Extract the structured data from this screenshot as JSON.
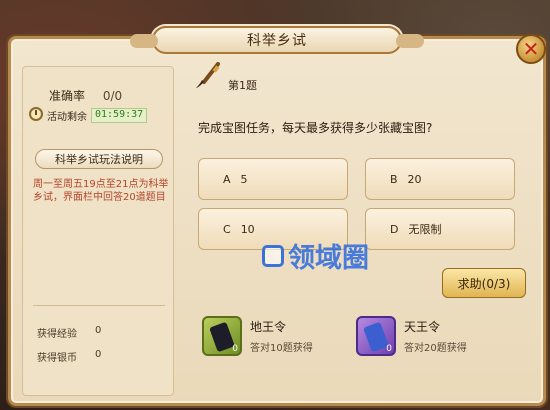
{
  "window": {
    "title": "科举乡试"
  },
  "stats": {
    "accuracy_label": "准确率",
    "accuracy_value": "0/0",
    "timer_label": "活动剩余",
    "timer_value": "01:59:37"
  },
  "rules": {
    "button_label": "科举乡试玩法说明",
    "description": "周一至周五19点至21点为科举乡试，界面栏中回答20道题目"
  },
  "rewards": {
    "exp_label": "获得经验",
    "exp_value": "0",
    "silver_label": "获得银币",
    "silver_value": "0"
  },
  "question": {
    "number_label": "第1题",
    "text": "完成宝图任务，每天最多获得多少张藏宝图?",
    "options": [
      {
        "letter": "A",
        "text": "5"
      },
      {
        "letter": "B",
        "text": "20"
      },
      {
        "letter": "C",
        "text": "10"
      },
      {
        "letter": "D",
        "text": "无限制"
      }
    ]
  },
  "help": {
    "label": "求助(0/3)"
  },
  "watermark": {
    "text": "领域圈"
  },
  "items": [
    {
      "name": "地王令",
      "desc": "答对10题获得",
      "count": "0",
      "icon": "green-scroll-icon"
    },
    {
      "name": "天王令",
      "desc": "答对20题获得",
      "count": "0",
      "icon": "purple-scroll-icon"
    }
  ],
  "colors": {
    "accent_gold": "#e0b552",
    "timer_green": "#2e7d1f",
    "rules_red": "#b4452a"
  }
}
